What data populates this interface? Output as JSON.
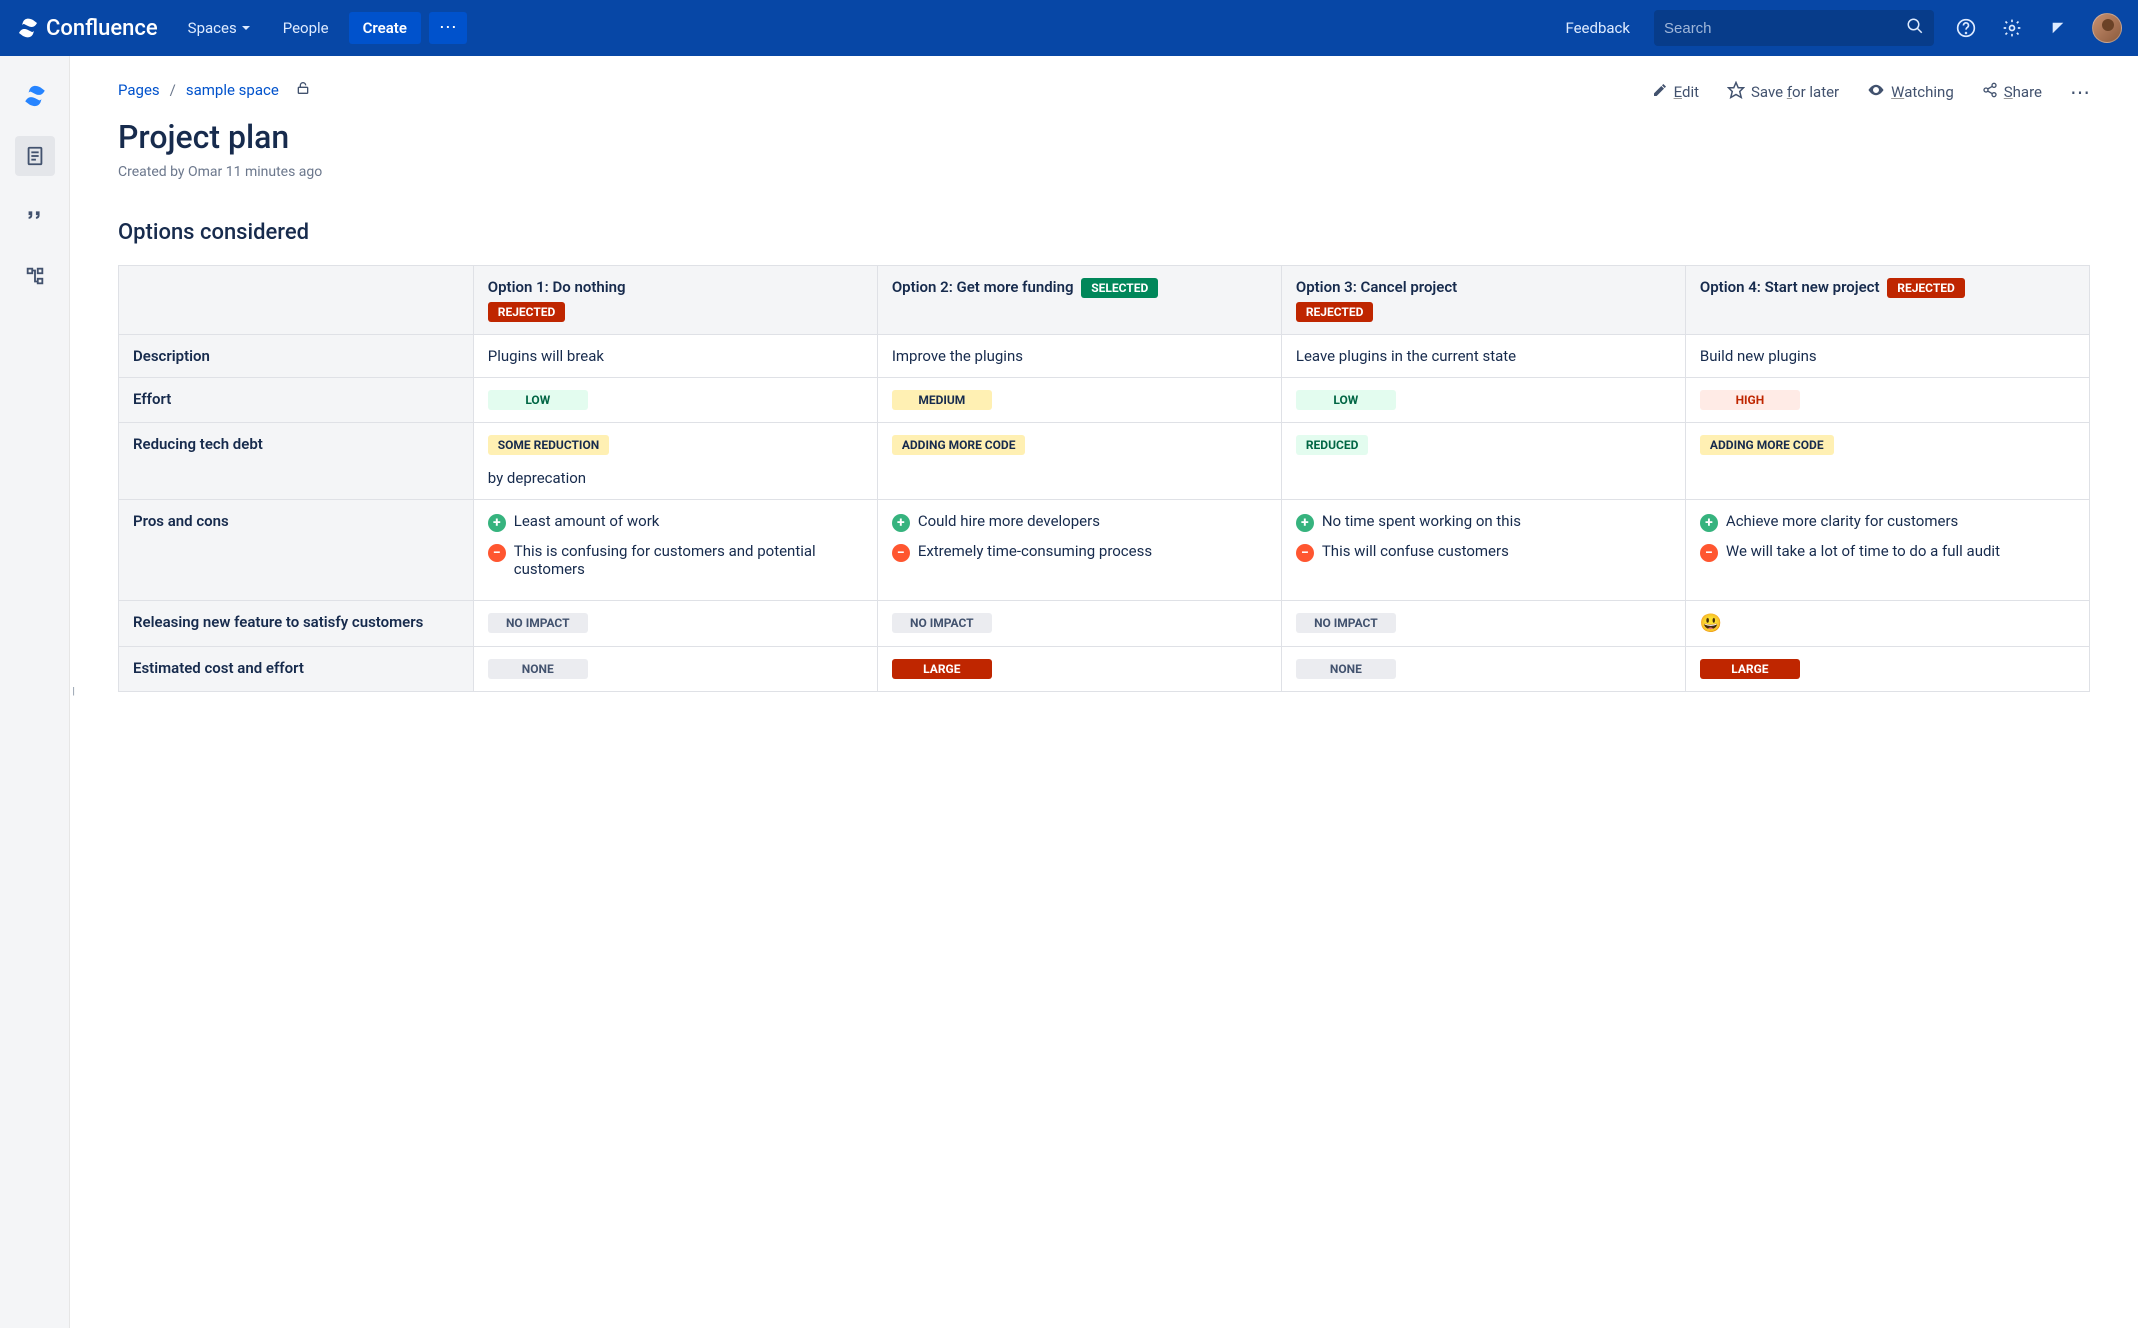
{
  "topnav": {
    "product": "Confluence",
    "spaces": "Spaces",
    "people": "People",
    "create": "Create",
    "feedback": "Feedback",
    "search_placeholder": "Search"
  },
  "breadcrumbs": {
    "pages": "Pages",
    "space": "sample space"
  },
  "actions": {
    "edit_pre": "E",
    "edit_ul": "dit",
    "save": "Save ",
    "save_ul": "f",
    "save_post": "or later",
    "watch_ul": "W",
    "watch_post": "atching",
    "share_ul": "S",
    "share_post": "hare"
  },
  "title": "Project plan",
  "byline": "Created by Omar 11 minutes ago",
  "section": "Options considered",
  "options": [
    {
      "title": "Option 1: Do nothing",
      "status": "REJECTED",
      "status_class": "loz-red"
    },
    {
      "title": "Option 2: Get more funding",
      "status": "SELECTED",
      "status_class": "loz-green"
    },
    {
      "title": "Option 3: Cancel project",
      "status": "REJECTED",
      "status_class": "loz-red"
    },
    {
      "title": "Option 4: Start new project",
      "status": "REJECTED",
      "status_class": "loz-red"
    }
  ],
  "rows": {
    "description": {
      "label": "Description",
      "cells": [
        "Plugins will break",
        "Improve the plugins",
        "Leave plugins in the current state",
        "Build new plugins"
      ]
    },
    "effort": {
      "label": "Effort",
      "cells": [
        {
          "text": "LOW",
          "class": "loz-low"
        },
        {
          "text": "MEDIUM",
          "class": "loz-med"
        },
        {
          "text": "LOW",
          "class": "loz-low"
        },
        {
          "text": "HIGH",
          "class": "loz-high"
        }
      ]
    },
    "techdebt": {
      "label": "Reducing tech debt",
      "cells": [
        {
          "text": "SOME REDUCTION",
          "class": "loz-yellow",
          "extra": "by deprecation"
        },
        {
          "text": "ADDING MORE CODE",
          "class": "loz-yellow"
        },
        {
          "text": "REDUCED",
          "class": "loz-reduced"
        },
        {
          "text": "ADDING MORE CODE",
          "class": "loz-yellow"
        }
      ]
    },
    "proscons": {
      "label": "Pros and cons",
      "cells": [
        {
          "pro": "Least amount of work",
          "con": "This is confusing for customers and potential customers"
        },
        {
          "pro": "Could hire more developers",
          "con": "Extremely time-consuming process"
        },
        {
          "pro": "No time spent working on this",
          "con": "This will confuse customers"
        },
        {
          "pro": "Achieve more clarity for customers",
          "con": "We will take a lot of time to do a full audit"
        }
      ]
    },
    "release": {
      "label": "Releasing new feature to satisfy customers",
      "cells": [
        {
          "text": "NO IMPACT",
          "class": "loz-gray"
        },
        {
          "text": "NO IMPACT",
          "class": "loz-gray"
        },
        {
          "text": "NO IMPACT",
          "class": "loz-gray"
        },
        {
          "emoji": "😃"
        }
      ]
    },
    "cost": {
      "label": "Estimated cost and effort",
      "cells": [
        {
          "text": "NONE",
          "class": "loz-gray"
        },
        {
          "text": "LARGE",
          "class": "loz-redwide"
        },
        {
          "text": "NONE",
          "class": "loz-gray"
        },
        {
          "text": "LARGE",
          "class": "loz-redwide"
        }
      ]
    }
  }
}
